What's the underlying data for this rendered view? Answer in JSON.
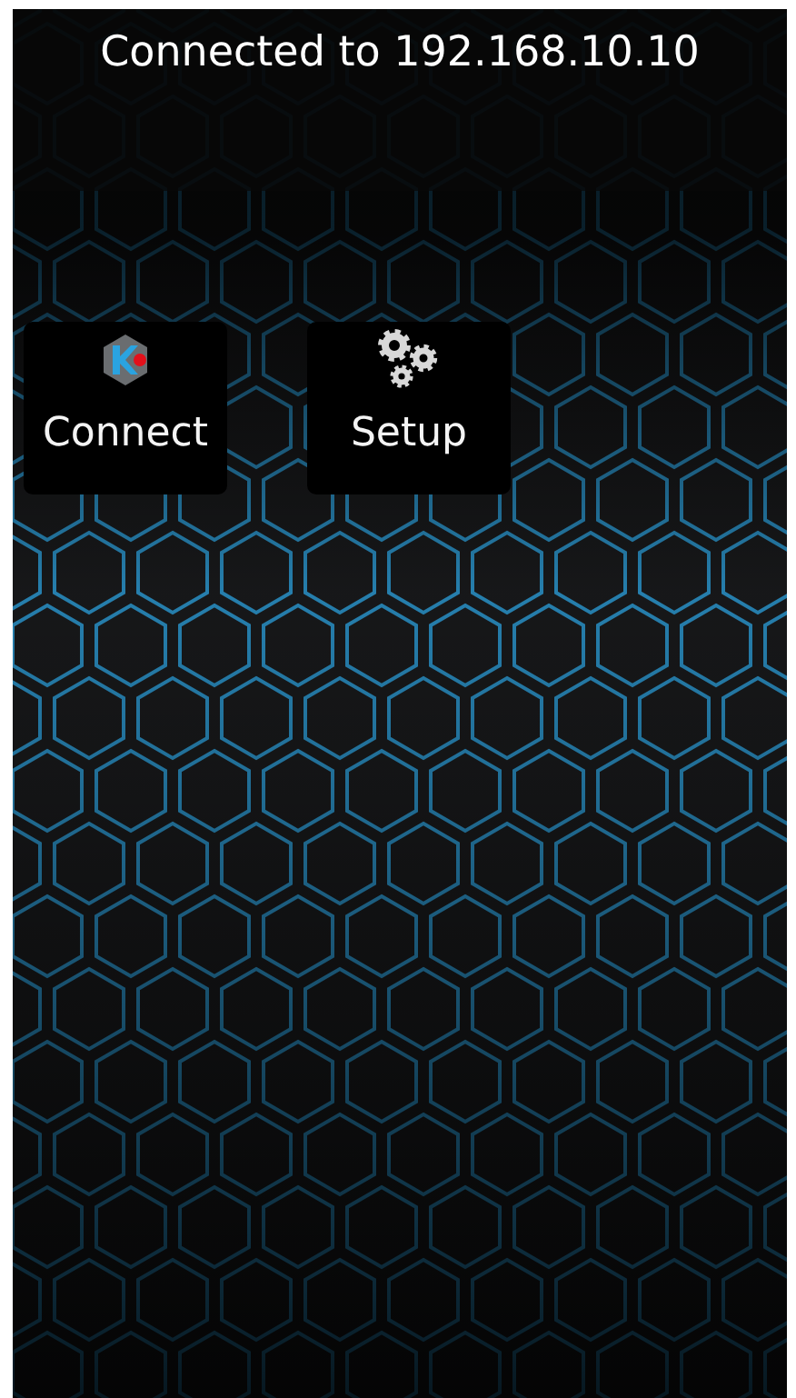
{
  "status": {
    "text": "Connected to 192.168.10.10"
  },
  "apps": [
    {
      "label": "Connect",
      "kind": "connect"
    },
    {
      "label": "Setup",
      "kind": "setup"
    }
  ]
}
